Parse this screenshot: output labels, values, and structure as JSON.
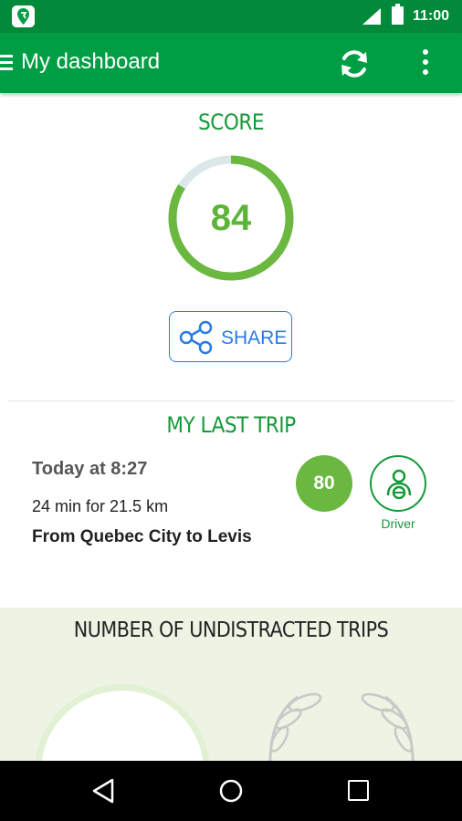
{
  "status_bar": {
    "time": "11:00"
  },
  "app_bar": {
    "title": "My dashboard"
  },
  "score": {
    "title": "SCORE",
    "value": "84",
    "fraction": 0.84,
    "ring_color": "#6ab840",
    "track_color": "#dce7ea"
  },
  "share": {
    "label": "SHARE"
  },
  "last_trip": {
    "title": "MY LAST TRIP",
    "time": "Today at 8:27",
    "distance": "24 min for 21.5 km",
    "route": "From Quebec City to Levis",
    "score": "80",
    "role": "Driver"
  },
  "undistracted": {
    "title": "NUMBER OF UNDISTRACTED TRIPS"
  },
  "colors": {
    "brand_green": "#009e44",
    "accent_blue": "#2a7be0"
  }
}
